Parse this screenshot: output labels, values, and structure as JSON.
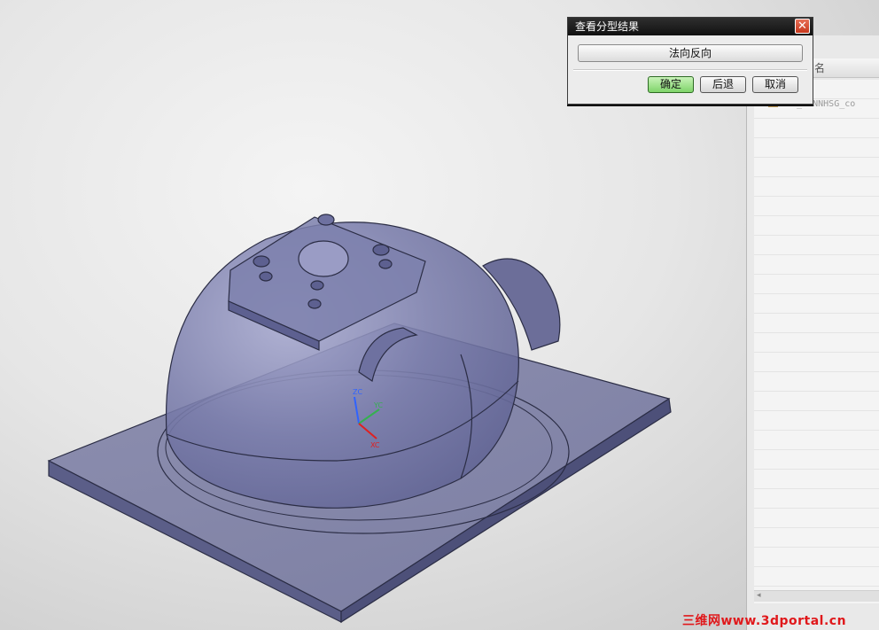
{
  "dialog": {
    "title": "查看分型结果",
    "flip_normal_label": "法向反向",
    "ok_label": "确定",
    "back_label": "后退",
    "cancel_label": "取消",
    "close_symbol": "✕"
  },
  "navigator": {
    "column_header": "名",
    "row_label": "MDP_CONNHSG_co"
  },
  "axes": {
    "zc": "ZC",
    "yc": "YC",
    "xc": "XC"
  },
  "watermark": "三维网www.3dportal.cn",
  "colors": {
    "model_fill": "#6c6f9c",
    "model_edge": "#2b2d45",
    "ok_button": "#8fdc7c",
    "close_button": "#d9482b"
  }
}
